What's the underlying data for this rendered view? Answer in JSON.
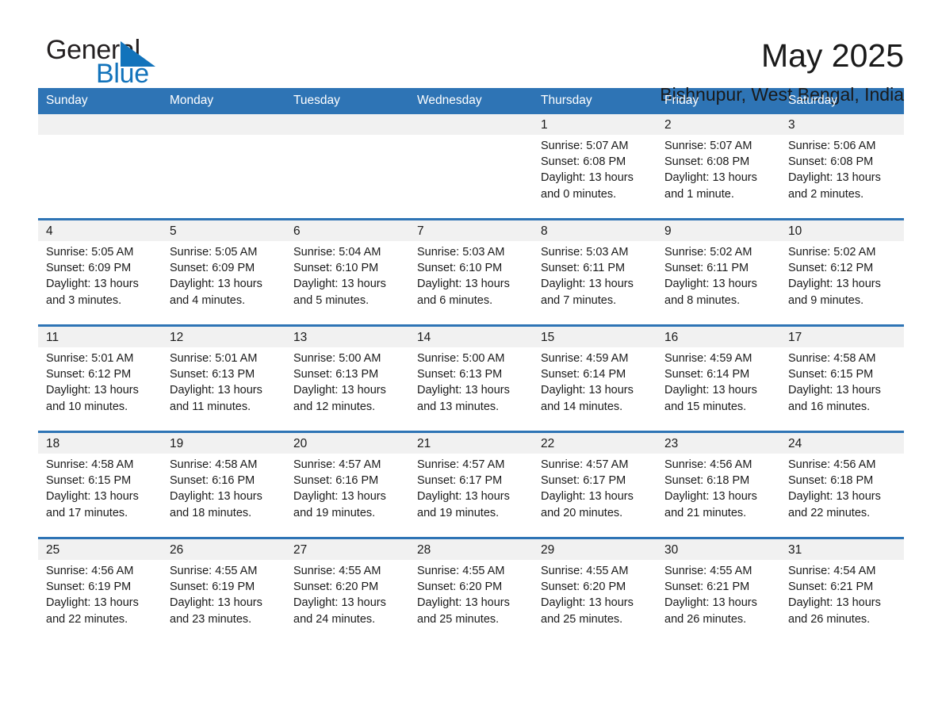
{
  "brand": {
    "name_part1": "General",
    "name_part2": "Blue",
    "triangle_color": "#1273bb",
    "text_color": "#231f20"
  },
  "header": {
    "month_title": "May 2025",
    "location": "Bishnupur, West Bengal, India"
  },
  "colors": {
    "header_blue": "#2e74b5",
    "daynum_band": "#f1f1f1",
    "text": "#1a1a1a",
    "header_text": "#ffffff"
  },
  "weekday_headers": [
    "Sunday",
    "Monday",
    "Tuesday",
    "Wednesday",
    "Thursday",
    "Friday",
    "Saturday"
  ],
  "labels": {
    "sunrise_prefix": "Sunrise:",
    "sunset_prefix": "Sunset:",
    "daylight_prefix": "Daylight:"
  },
  "weeks": [
    [
      {
        "day": "",
        "empty": true,
        "sunrise": "",
        "sunset": "",
        "daylight_line1": "",
        "daylight_line2": ""
      },
      {
        "day": "",
        "empty": true,
        "sunrise": "",
        "sunset": "",
        "daylight_line1": "",
        "daylight_line2": ""
      },
      {
        "day": "",
        "empty": true,
        "sunrise": "",
        "sunset": "",
        "daylight_line1": "",
        "daylight_line2": ""
      },
      {
        "day": "",
        "empty": true,
        "sunrise": "",
        "sunset": "",
        "daylight_line1": "",
        "daylight_line2": ""
      },
      {
        "day": "1",
        "empty": false,
        "sunrise": "Sunrise: 5:07 AM",
        "sunset": "Sunset: 6:08 PM",
        "daylight_line1": "Daylight: 13 hours",
        "daylight_line2": "and 0 minutes."
      },
      {
        "day": "2",
        "empty": false,
        "sunrise": "Sunrise: 5:07 AM",
        "sunset": "Sunset: 6:08 PM",
        "daylight_line1": "Daylight: 13 hours",
        "daylight_line2": "and 1 minute."
      },
      {
        "day": "3",
        "empty": false,
        "sunrise": "Sunrise: 5:06 AM",
        "sunset": "Sunset: 6:08 PM",
        "daylight_line1": "Daylight: 13 hours",
        "daylight_line2": "and 2 minutes."
      }
    ],
    [
      {
        "day": "4",
        "empty": false,
        "sunrise": "Sunrise: 5:05 AM",
        "sunset": "Sunset: 6:09 PM",
        "daylight_line1": "Daylight: 13 hours",
        "daylight_line2": "and 3 minutes."
      },
      {
        "day": "5",
        "empty": false,
        "sunrise": "Sunrise: 5:05 AM",
        "sunset": "Sunset: 6:09 PM",
        "daylight_line1": "Daylight: 13 hours",
        "daylight_line2": "and 4 minutes."
      },
      {
        "day": "6",
        "empty": false,
        "sunrise": "Sunrise: 5:04 AM",
        "sunset": "Sunset: 6:10 PM",
        "daylight_line1": "Daylight: 13 hours",
        "daylight_line2": "and 5 minutes."
      },
      {
        "day": "7",
        "empty": false,
        "sunrise": "Sunrise: 5:03 AM",
        "sunset": "Sunset: 6:10 PM",
        "daylight_line1": "Daylight: 13 hours",
        "daylight_line2": "and 6 minutes."
      },
      {
        "day": "8",
        "empty": false,
        "sunrise": "Sunrise: 5:03 AM",
        "sunset": "Sunset: 6:11 PM",
        "daylight_line1": "Daylight: 13 hours",
        "daylight_line2": "and 7 minutes."
      },
      {
        "day": "9",
        "empty": false,
        "sunrise": "Sunrise: 5:02 AM",
        "sunset": "Sunset: 6:11 PM",
        "daylight_line1": "Daylight: 13 hours",
        "daylight_line2": "and 8 minutes."
      },
      {
        "day": "10",
        "empty": false,
        "sunrise": "Sunrise: 5:02 AM",
        "sunset": "Sunset: 6:12 PM",
        "daylight_line1": "Daylight: 13 hours",
        "daylight_line2": "and 9 minutes."
      }
    ],
    [
      {
        "day": "11",
        "empty": false,
        "sunrise": "Sunrise: 5:01 AM",
        "sunset": "Sunset: 6:12 PM",
        "daylight_line1": "Daylight: 13 hours",
        "daylight_line2": "and 10 minutes."
      },
      {
        "day": "12",
        "empty": false,
        "sunrise": "Sunrise: 5:01 AM",
        "sunset": "Sunset: 6:13 PM",
        "daylight_line1": "Daylight: 13 hours",
        "daylight_line2": "and 11 minutes."
      },
      {
        "day": "13",
        "empty": false,
        "sunrise": "Sunrise: 5:00 AM",
        "sunset": "Sunset: 6:13 PM",
        "daylight_line1": "Daylight: 13 hours",
        "daylight_line2": "and 12 minutes."
      },
      {
        "day": "14",
        "empty": false,
        "sunrise": "Sunrise: 5:00 AM",
        "sunset": "Sunset: 6:13 PM",
        "daylight_line1": "Daylight: 13 hours",
        "daylight_line2": "and 13 minutes."
      },
      {
        "day": "15",
        "empty": false,
        "sunrise": "Sunrise: 4:59 AM",
        "sunset": "Sunset: 6:14 PM",
        "daylight_line1": "Daylight: 13 hours",
        "daylight_line2": "and 14 minutes."
      },
      {
        "day": "16",
        "empty": false,
        "sunrise": "Sunrise: 4:59 AM",
        "sunset": "Sunset: 6:14 PM",
        "daylight_line1": "Daylight: 13 hours",
        "daylight_line2": "and 15 minutes."
      },
      {
        "day": "17",
        "empty": false,
        "sunrise": "Sunrise: 4:58 AM",
        "sunset": "Sunset: 6:15 PM",
        "daylight_line1": "Daylight: 13 hours",
        "daylight_line2": "and 16 minutes."
      }
    ],
    [
      {
        "day": "18",
        "empty": false,
        "sunrise": "Sunrise: 4:58 AM",
        "sunset": "Sunset: 6:15 PM",
        "daylight_line1": "Daylight: 13 hours",
        "daylight_line2": "and 17 minutes."
      },
      {
        "day": "19",
        "empty": false,
        "sunrise": "Sunrise: 4:58 AM",
        "sunset": "Sunset: 6:16 PM",
        "daylight_line1": "Daylight: 13 hours",
        "daylight_line2": "and 18 minutes."
      },
      {
        "day": "20",
        "empty": false,
        "sunrise": "Sunrise: 4:57 AM",
        "sunset": "Sunset: 6:16 PM",
        "daylight_line1": "Daylight: 13 hours",
        "daylight_line2": "and 19 minutes."
      },
      {
        "day": "21",
        "empty": false,
        "sunrise": "Sunrise: 4:57 AM",
        "sunset": "Sunset: 6:17 PM",
        "daylight_line1": "Daylight: 13 hours",
        "daylight_line2": "and 19 minutes."
      },
      {
        "day": "22",
        "empty": false,
        "sunrise": "Sunrise: 4:57 AM",
        "sunset": "Sunset: 6:17 PM",
        "daylight_line1": "Daylight: 13 hours",
        "daylight_line2": "and 20 minutes."
      },
      {
        "day": "23",
        "empty": false,
        "sunrise": "Sunrise: 4:56 AM",
        "sunset": "Sunset: 6:18 PM",
        "daylight_line1": "Daylight: 13 hours",
        "daylight_line2": "and 21 minutes."
      },
      {
        "day": "24",
        "empty": false,
        "sunrise": "Sunrise: 4:56 AM",
        "sunset": "Sunset: 6:18 PM",
        "daylight_line1": "Daylight: 13 hours",
        "daylight_line2": "and 22 minutes."
      }
    ],
    [
      {
        "day": "25",
        "empty": false,
        "sunrise": "Sunrise: 4:56 AM",
        "sunset": "Sunset: 6:19 PM",
        "daylight_line1": "Daylight: 13 hours",
        "daylight_line2": "and 22 minutes."
      },
      {
        "day": "26",
        "empty": false,
        "sunrise": "Sunrise: 4:55 AM",
        "sunset": "Sunset: 6:19 PM",
        "daylight_line1": "Daylight: 13 hours",
        "daylight_line2": "and 23 minutes."
      },
      {
        "day": "27",
        "empty": false,
        "sunrise": "Sunrise: 4:55 AM",
        "sunset": "Sunset: 6:20 PM",
        "daylight_line1": "Daylight: 13 hours",
        "daylight_line2": "and 24 minutes."
      },
      {
        "day": "28",
        "empty": false,
        "sunrise": "Sunrise: 4:55 AM",
        "sunset": "Sunset: 6:20 PM",
        "daylight_line1": "Daylight: 13 hours",
        "daylight_line2": "and 25 minutes."
      },
      {
        "day": "29",
        "empty": false,
        "sunrise": "Sunrise: 4:55 AM",
        "sunset": "Sunset: 6:20 PM",
        "daylight_line1": "Daylight: 13 hours",
        "daylight_line2": "and 25 minutes."
      },
      {
        "day": "30",
        "empty": false,
        "sunrise": "Sunrise: 4:55 AM",
        "sunset": "Sunset: 6:21 PM",
        "daylight_line1": "Daylight: 13 hours",
        "daylight_line2": "and 26 minutes."
      },
      {
        "day": "31",
        "empty": false,
        "sunrise": "Sunrise: 4:54 AM",
        "sunset": "Sunset: 6:21 PM",
        "daylight_line1": "Daylight: 13 hours",
        "daylight_line2": "and 26 minutes."
      }
    ]
  ]
}
